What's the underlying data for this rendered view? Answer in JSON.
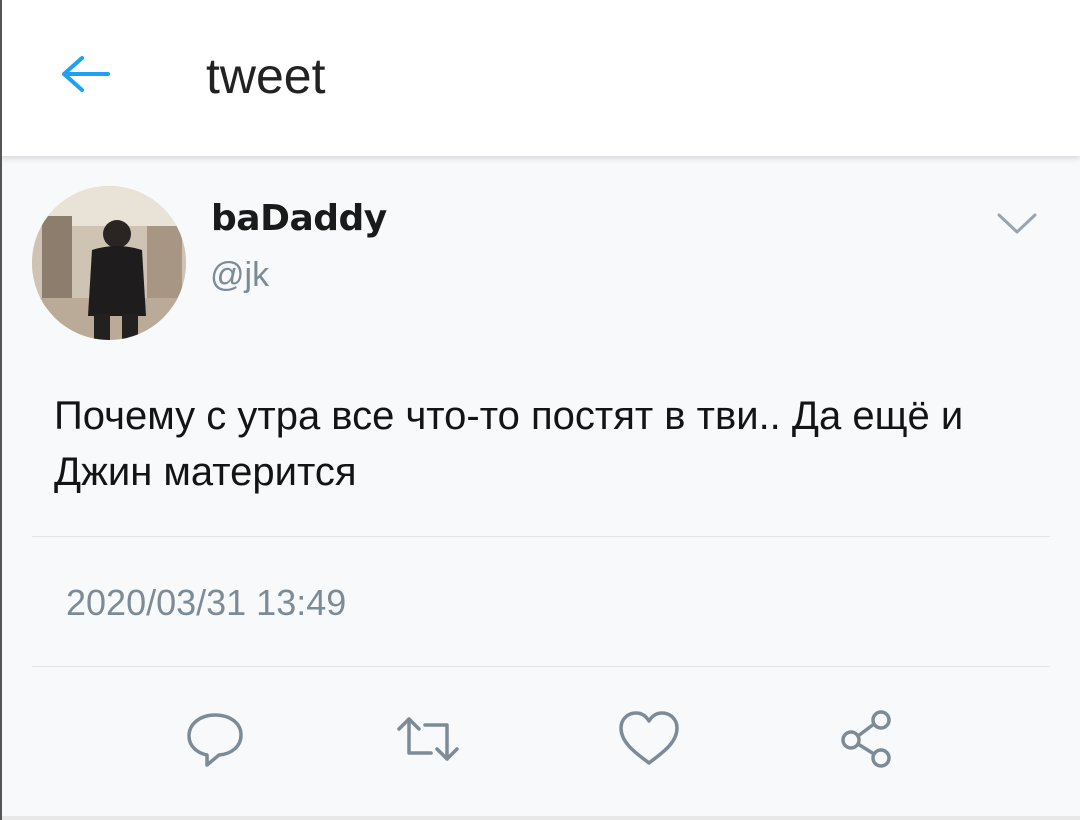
{
  "header": {
    "back_icon": "arrow-left-icon",
    "title": "tweet"
  },
  "tweet": {
    "display_name": "baDaddy",
    "handle": "@jk",
    "text": "Почему с утра все что-то постят в тви.. Да ещё и Джин матерится",
    "timestamp": "2020/03/31 13:49",
    "menu_icon": "chevron-down-icon"
  },
  "actions": [
    {
      "name": "reply",
      "icon": "speech-bubble-icon"
    },
    {
      "name": "retweet",
      "icon": "retweet-icon"
    },
    {
      "name": "like",
      "icon": "heart-icon"
    },
    {
      "name": "share",
      "icon": "share-icon"
    }
  ],
  "colors": {
    "accent": "#1da1f2",
    "icon_gray": "#7d8b97",
    "background": "#f8f9fb"
  }
}
